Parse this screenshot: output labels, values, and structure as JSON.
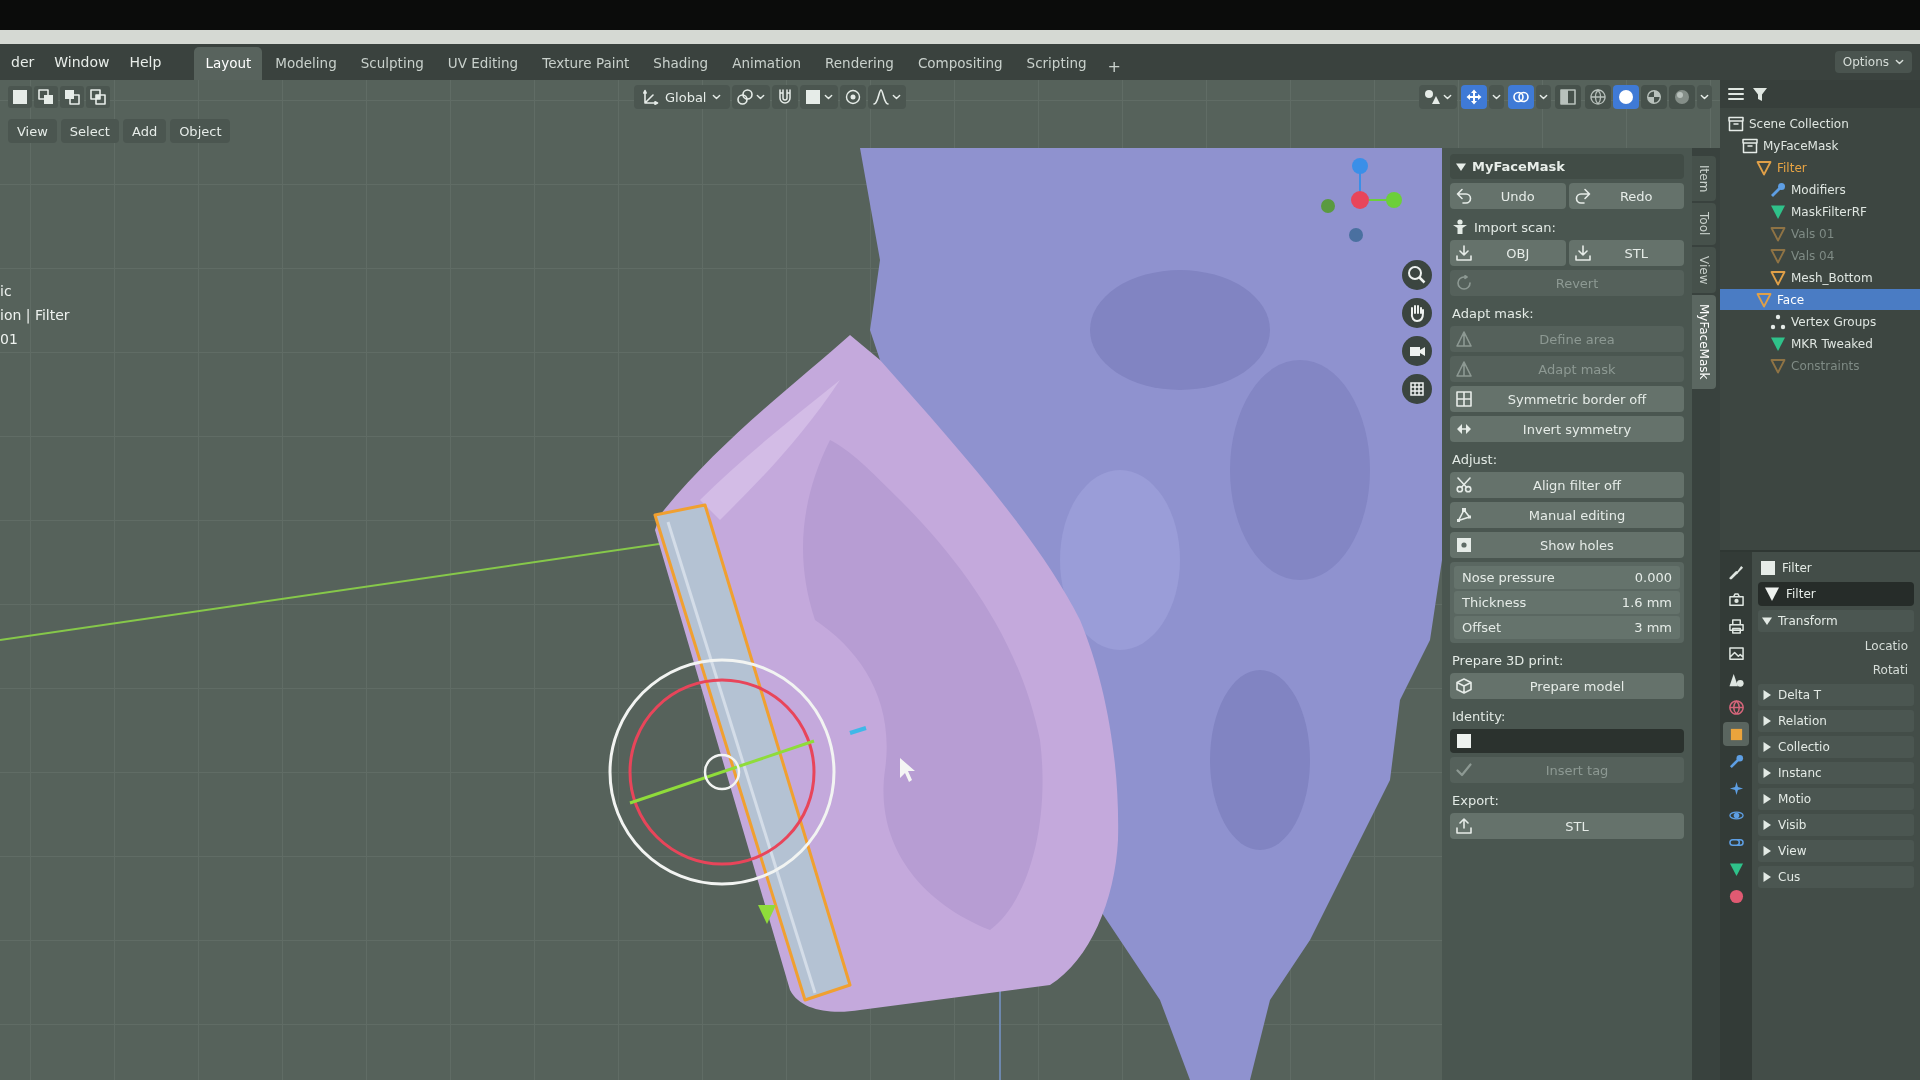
{
  "top_bar": {
    "menus": [
      "der",
      "Window",
      "Help"
    ],
    "workspaces": [
      {
        "label": "Layout",
        "selected": true
      },
      {
        "label": "Modeling",
        "selected": false
      },
      {
        "label": "Sculpting",
        "selected": false
      },
      {
        "label": "UV Editing",
        "selected": false
      },
      {
        "label": "Texture Paint",
        "selected": false
      },
      {
        "label": "Shading",
        "selected": false
      },
      {
        "label": "Animation",
        "selected": false
      },
      {
        "label": "Rendering",
        "selected": false
      },
      {
        "label": "Compositing",
        "selected": false
      },
      {
        "label": "Scripting",
        "selected": false
      }
    ],
    "add_workspace": "+",
    "options": "Options"
  },
  "tool_header": {
    "orientation": "Global"
  },
  "viewport_header": {
    "menus": [
      "View",
      "Select",
      "Add",
      "Object"
    ],
    "toggles": [
      {
        "on": true
      },
      {
        "on": true
      },
      {
        "on": false
      }
    ],
    "shading_modes": [
      {
        "selected": false
      },
      {
        "selected": true
      },
      {
        "selected": false
      },
      {
        "selected": false
      }
    ]
  },
  "viewport": {
    "info_lines": [
      "ic",
      "ion | Filter",
      "01"
    ]
  },
  "sidebar": {
    "tabs": [
      {
        "label": "Item",
        "selected": false
      },
      {
        "label": "Tool",
        "selected": false
      },
      {
        "label": "View",
        "selected": false
      },
      {
        "label": "MyFaceMask",
        "selected": true
      }
    ],
    "panel": {
      "title": "MyFaceMask",
      "expanded": true,
      "rows": [
        {
          "kind": "buttons",
          "buttons": [
            {
              "label": "Undo",
              "disabled": false
            },
            {
              "label": "Redo",
              "disabled": false
            }
          ]
        },
        {
          "kind": "heading",
          "label": "Import scan:"
        },
        {
          "kind": "buttons",
          "buttons": [
            {
              "label": "OBJ",
              "disabled": false
            },
            {
              "label": "STL",
              "disabled": false
            }
          ]
        },
        {
          "kind": "buttons",
          "buttons": [
            {
              "label": "Revert",
              "disabled": true
            }
          ]
        },
        {
          "kind": "heading",
          "label": "Adapt mask:"
        },
        {
          "kind": "buttons",
          "buttons": [
            {
              "label": "Define area",
              "disabled": true
            }
          ]
        },
        {
          "kind": "buttons",
          "buttons": [
            {
              "label": "Adapt mask",
              "disabled": true
            }
          ]
        },
        {
          "kind": "buttons",
          "buttons": [
            {
              "label": "Symmetric border off",
              "disabled": false
            }
          ]
        },
        {
          "kind": "buttons",
          "buttons": [
            {
              "label": "Invert symmetry",
              "disabled": false
            }
          ]
        },
        {
          "kind": "heading",
          "label": "Adjust:"
        },
        {
          "kind": "buttons",
          "buttons": [
            {
              "label": "Align filter off",
              "disabled": false
            }
          ]
        },
        {
          "kind": "buttons",
          "buttons": [
            {
              "label": "Manual editing",
              "disabled": false
            }
          ]
        },
        {
          "kind": "buttons",
          "buttons": [
            {
              "label": "Show holes",
              "disabled": false
            }
          ]
        },
        {
          "kind": "numbers",
          "fields": [
            {
              "label": "Nose pressure",
              "value": "0.000"
            },
            {
              "label": "Thickness",
              "value": "1.6 mm"
            },
            {
              "label": "Offset",
              "value": "3 mm"
            }
          ]
        },
        {
          "kind": "heading",
          "label": "Prepare 3D print:"
        },
        {
          "kind": "buttons",
          "buttons": [
            {
              "label": "Prepare model",
              "disabled": false
            }
          ]
        },
        {
          "kind": "heading",
          "label": "Identity:"
        },
        {
          "kind": "text_field"
        },
        {
          "kind": "buttons",
          "buttons": [
            {
              "label": "Insert tag",
              "disabled": true
            }
          ]
        },
        {
          "kind": "heading",
          "label": "Export:"
        },
        {
          "kind": "buttons",
          "buttons": [
            {
              "label": "STL",
              "disabled": false
            }
          ]
        }
      ]
    }
  },
  "outliner": {
    "items": [
      {
        "label": "Scene Collection",
        "kind": "collection",
        "selected": false,
        "active": false,
        "dimmed": false,
        "children": [
          {
            "label": "MyFaceMask",
            "kind": "collection",
            "selected": false,
            "active": false,
            "dimmed": false,
            "children": [
              {
                "label": "Filter",
                "kind": "object",
                "selected": false,
                "active": true,
                "dimmed": false,
                "children": [
                  {
                    "label": "Modifiers",
                    "kind": "modifiers",
                    "selected": false,
                    "active": false,
                    "dimmed": false
                  },
                  {
                    "label": "MaskFilterRF",
                    "kind": "mesh",
                    "selected": false,
                    "active": false,
                    "dimmed": false
                  },
                  {
                    "label": "Vals 01",
                    "kind": "object",
                    "selected": false,
                    "active": false,
                    "dimmed": true
                  },
                  {
                    "label": "Vals 04",
                    "kind": "object",
                    "selected": false,
                    "active": false,
                    "dimmed": true
                  },
                  {
                    "label": "Mesh_Bottom",
                    "kind": "object",
                    "selected": false,
                    "active": false,
                    "dimmed": false
                  }
                ]
              },
              {
                "label": "Face",
                "kind": "object",
                "selected": true,
                "active": false,
                "dimmed": false,
                "children": [
                  {
                    "label": "Vertex Groups",
                    "kind": "vertex_groups",
                    "selected": false,
                    "active": false,
                    "dimmed": false
                  },
                  {
                    "label": "MKR Tweaked",
                    "kind": "mesh",
                    "selected": false,
                    "active": false,
                    "dimmed": false
                  },
                  {
                    "label": "Constraints",
                    "kind": "object",
                    "selected": false,
                    "active": false,
                    "dimmed": true
                  }
                ]
              }
            ]
          }
        ]
      }
    ]
  },
  "properties": {
    "tabs": [
      {
        "selected": false
      },
      {
        "selected": false
      },
      {
        "selected": false
      },
      {
        "selected": false
      },
      {
        "selected": false
      },
      {
        "selected": false
      },
      {
        "selected": true
      },
      {
        "selected": false
      },
      {
        "selected": false
      },
      {
        "selected": false
      },
      {
        "selected": false
      },
      {
        "selected": false
      },
      {
        "selected": false
      }
    ],
    "object_name": "Filter",
    "data_name": "Filter",
    "panels": [
      {
        "label": "Transform",
        "expanded": true,
        "rows": [
          "Locatio",
          "Rotati"
        ]
      },
      {
        "label": "Delta T",
        "expanded": false
      },
      {
        "label": "Relation",
        "expanded": false
      },
      {
        "label": "Collectio",
        "expanded": false
      },
      {
        "label": "Instanc",
        "expanded": false
      },
      {
        "label": "Motio",
        "expanded": false
      },
      {
        "label": "Visib",
        "expanded": false
      },
      {
        "label": "View",
        "expanded": false
      },
      {
        "label": "Cus",
        "expanded": false
      }
    ]
  }
}
